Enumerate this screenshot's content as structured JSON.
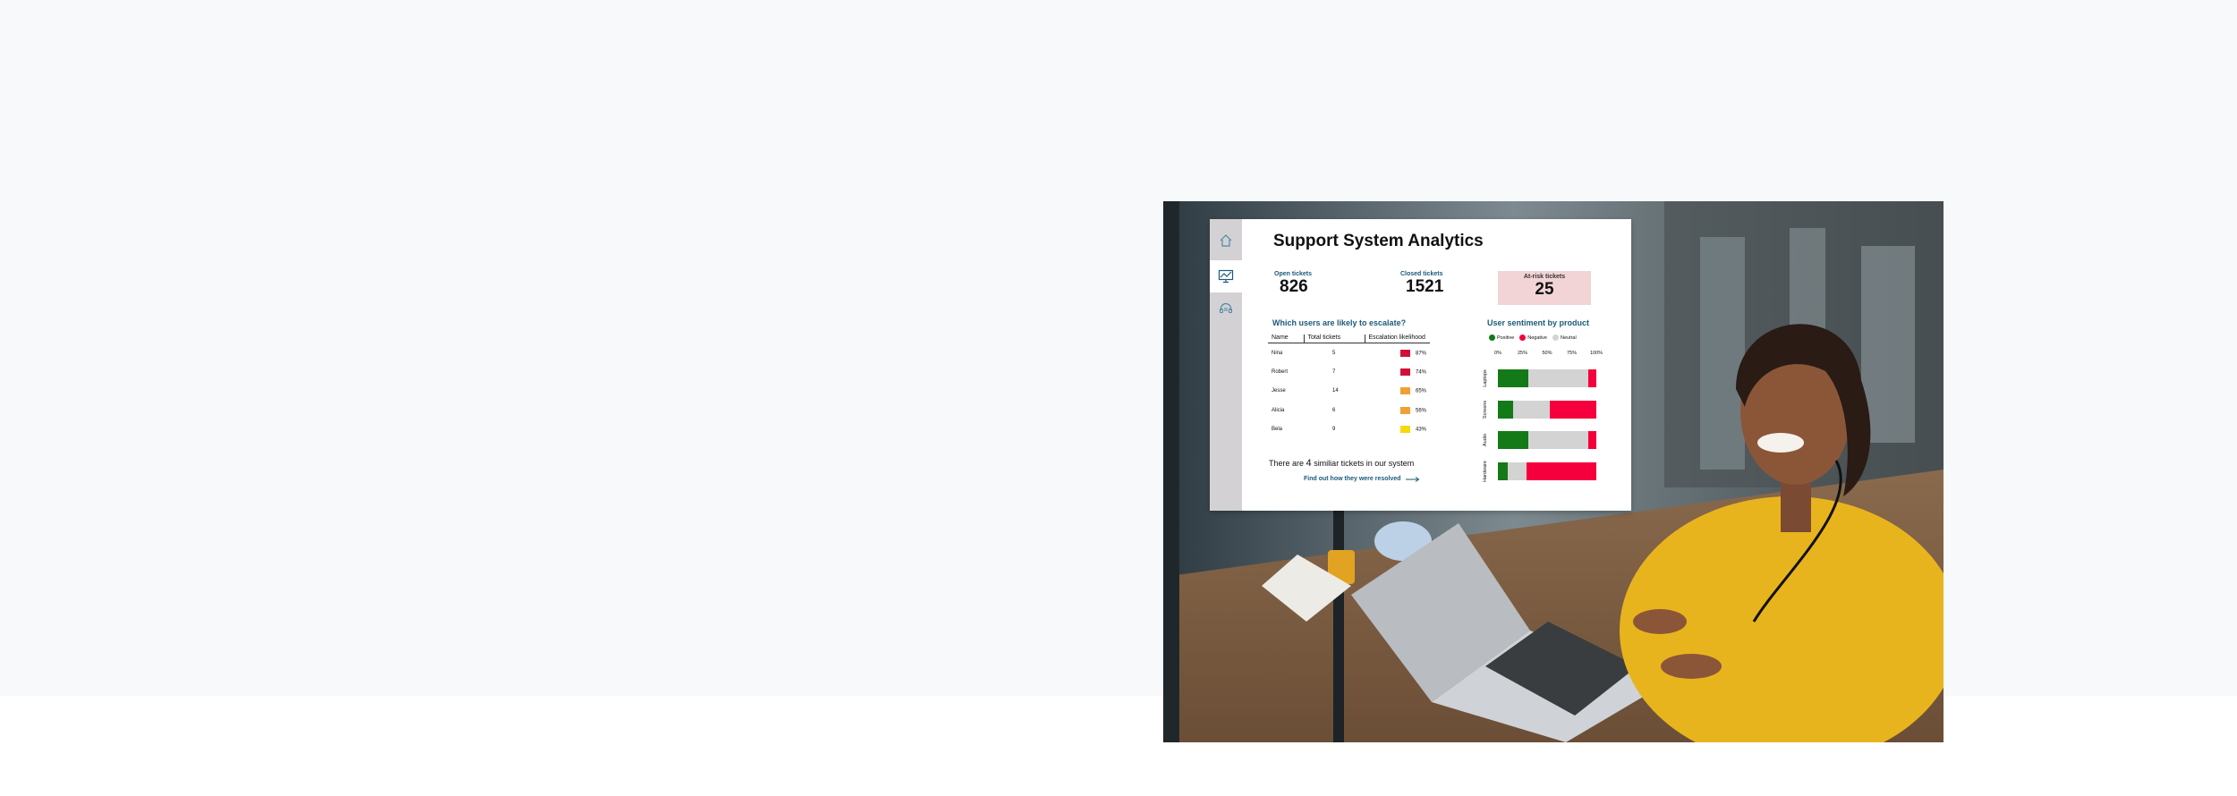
{
  "dashboard": {
    "title": "Support System Analytics",
    "nav": [
      {
        "icon": "home-icon"
      },
      {
        "icon": "analytics-monitor-icon"
      },
      {
        "icon": "headset-icon"
      }
    ],
    "kpis": {
      "open": {
        "label": "Open tickets",
        "value": "826"
      },
      "closed": {
        "label": "Closed tickets",
        "value": "1521"
      },
      "at_risk": {
        "label": "At-risk tickets",
        "value": "25"
      }
    },
    "escalation": {
      "title": "Which users are likely to escalate?",
      "columns": [
        "Name",
        "Total tickets",
        "Escalation likelihood"
      ],
      "rows": [
        {
          "name": "Nina",
          "tickets": "5",
          "likelihood": "87%",
          "color": "#d0103a"
        },
        {
          "name": "Robert",
          "tickets": "7",
          "likelihood": "74%",
          "color": "#d0103a"
        },
        {
          "name": "Jesse",
          "tickets": "14",
          "likelihood": "65%",
          "color": "#f0a035"
        },
        {
          "name": "Alicia",
          "tickets": "6",
          "likelihood": "56%",
          "color": "#f0a035"
        },
        {
          "name": "Bela",
          "tickets": "9",
          "likelihood": "43%",
          "color": "#f5d90a"
        }
      ]
    },
    "similar": {
      "prefix": "There are",
      "count": "4",
      "suffix": "similiar tickets in our system"
    },
    "link": {
      "label": "Find out how they were resolved"
    },
    "sentiment": {
      "title": "User sentiment by product",
      "legend": [
        {
          "label": "Positive",
          "color": "#137a17"
        },
        {
          "label": "Negative",
          "color": "#f5003c"
        },
        {
          "label": "Neutral",
          "color": "#d3d3d3"
        }
      ],
      "ticks": [
        "0%",
        "25%",
        "50%",
        "75%",
        "100%"
      ],
      "chart_data": {
        "type": "bar",
        "orientation": "horizontal-stacked",
        "categories": [
          "Laptops",
          "Screens",
          "Audio",
          "Hardware"
        ],
        "xlim": [
          0,
          100
        ],
        "series": [
          {
            "name": "Positive",
            "values": [
              31,
              15,
              31,
              10
            ]
          },
          {
            "name": "Neutral",
            "values": [
              61,
              38,
              61,
              19
            ]
          },
          {
            "name": "Negative",
            "values": [
              8,
              47,
              8,
              71
            ]
          }
        ]
      }
    }
  }
}
